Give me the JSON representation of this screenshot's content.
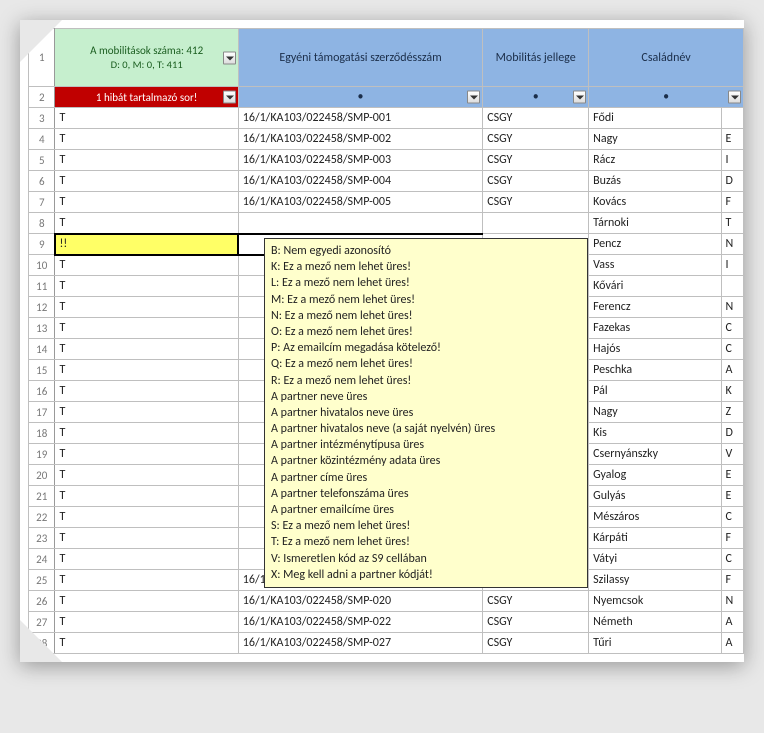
{
  "header": {
    "summary_line1": "A mobilitások száma: 412",
    "summary_line2": "D: 0, M: 0, T: 411",
    "error_label": "1 hibát tartalmazó sor!",
    "col_contract": "Egyéni támogatási szerződésszám",
    "col_type": "Mobilitás jellege",
    "col_name": "Családnév",
    "filter_dot": "•"
  },
  "row_numbers": [
    "1",
    "2",
    "3",
    "4",
    "5",
    "6",
    "7",
    "8",
    "9",
    "10",
    "11",
    "12",
    "13",
    "14",
    "15",
    "16",
    "17",
    "18",
    "19",
    "20",
    "21",
    "22",
    "23",
    "24"
  ],
  "rows": [
    {
      "status": "T",
      "contract": "16/1/KA103/022458/SMP-001",
      "type": "CSGY",
      "name": "Fődi",
      "clip": ""
    },
    {
      "status": "T",
      "contract": "16/1/KA103/022458/SMP-002",
      "type": "CSGY",
      "name": "Nagy",
      "clip": "E"
    },
    {
      "status": "T",
      "contract": "16/1/KA103/022458/SMP-003",
      "type": "CSGY",
      "name": "Rácz",
      "clip": "I"
    },
    {
      "status": "T",
      "contract": "16/1/KA103/022458/SMP-004",
      "type": "CSGY",
      "name": "Buzás",
      "clip": "D"
    },
    {
      "status": "T",
      "contract": "16/1/KA103/022458/SMP-005",
      "type": "CSGY",
      "name": "Kovács",
      "clip": "F"
    },
    {
      "status": "T",
      "contract": "",
      "type": "",
      "name": "Tárnoki",
      "clip": "T"
    },
    {
      "status": "!!",
      "contract": "",
      "type": "",
      "name": "Pencz",
      "clip": "N"
    },
    {
      "status": "T",
      "contract": "",
      "type": "",
      "name": "Vass",
      "clip": "I"
    },
    {
      "status": "T",
      "contract": "",
      "type": "",
      "name": "Kővári",
      "clip": ""
    },
    {
      "status": "T",
      "contract": "",
      "type": "",
      "name": "Ferencz",
      "clip": "N"
    },
    {
      "status": "T",
      "contract": "",
      "type": "",
      "name": "Fazekas",
      "clip": "C"
    },
    {
      "status": "T",
      "contract": "",
      "type": "",
      "name": "Hajós",
      "clip": "C"
    },
    {
      "status": "T",
      "contract": "",
      "type": "",
      "name": "Peschka",
      "clip": "A"
    },
    {
      "status": "T",
      "contract": "",
      "type": "",
      "name": "Pál",
      "clip": "K"
    },
    {
      "status": "T",
      "contract": "",
      "type": "",
      "name": "Nagy",
      "clip": "Z"
    },
    {
      "status": "T",
      "contract": "",
      "type": "",
      "name": "Kis",
      "clip": "D"
    },
    {
      "status": "T",
      "contract": "",
      "type": "",
      "name": "Csernyánszky",
      "clip": "V"
    },
    {
      "status": "T",
      "contract": "",
      "type": "",
      "name": "Gyalog",
      "clip": "E"
    },
    {
      "status": "T",
      "contract": "",
      "type": "",
      "name": "Gulyás",
      "clip": "E"
    },
    {
      "status": "T",
      "contract": "",
      "type": "",
      "name": "Mészáros",
      "clip": "C"
    },
    {
      "status": "T",
      "contract": "",
      "type": "",
      "name": "Kárpáti",
      "clip": "F"
    },
    {
      "status": "T",
      "contract": "",
      "type": "",
      "name": "Vátyi",
      "clip": "C"
    },
    {
      "status": "T",
      "contract": "16/1/KA103/022458/SMP-030",
      "type": "CSGY",
      "name": "Szilassy",
      "clip": "F"
    },
    {
      "status": "T",
      "contract": "16/1/KA103/022458/SMP-020",
      "type": "CSGY",
      "name": "Nyemcsok",
      "clip": "N"
    },
    {
      "status": "T",
      "contract": "16/1/KA103/022458/SMP-022",
      "type": "CSGY",
      "name": "Németh",
      "clip": "A"
    },
    {
      "status": "T",
      "contract": "16/1/KA103/022458/SMP-027",
      "type": "CSGY",
      "name": "Tűri",
      "clip": "A"
    }
  ],
  "selected_row_index": 6,
  "tooltip_lines": [
    "B: Nem egyedi azonosító",
    "K: Ez a mező nem lehet üres!",
    "L: Ez a mező nem lehet üres!",
    "M: Ez a mező nem lehet üres!",
    "N: Ez a mező nem lehet üres!",
    "O: Ez a mező nem lehet üres!",
    "P: Az emailcím megadása kötelező!",
    "Q: Ez a mező nem lehet üres!",
    "R: Ez a mező nem lehet üres!",
    "A partner neve üres",
    "A partner hivatalos neve üres",
    "A partner hivatalos neve (a saját nyelvén) üres",
    "A partner intézménytípusa üres",
    "A partner közintézmény adata üres",
    "A partner címe üres",
    "A partner telefonszáma üres",
    "A partner emailcíme üres",
    "S: Ez a mező nem lehet üres!",
    "T: Ez a mező nem lehet üres!",
    "V: Ismeretlen kód az S9 cellában",
    "X: Meg kell adni a partner kódját!"
  ]
}
